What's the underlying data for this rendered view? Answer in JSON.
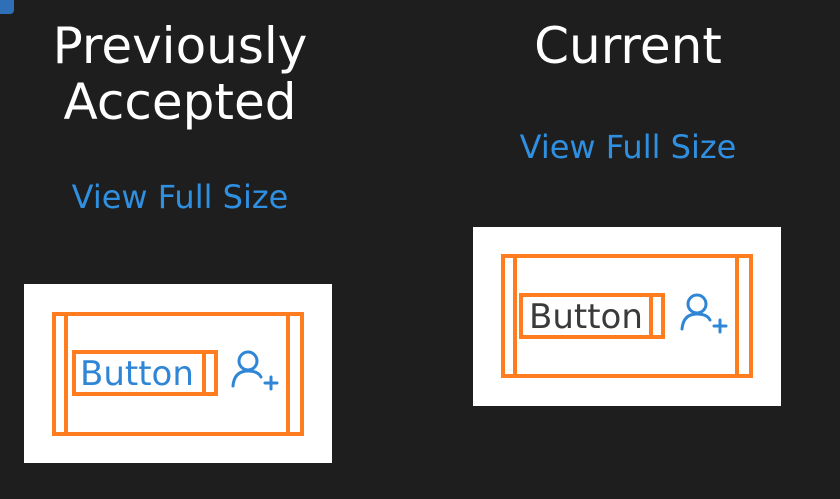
{
  "previous": {
    "heading": "Previously Accepted",
    "link_label": "View Full Size",
    "button_label": "Button"
  },
  "current": {
    "heading": "Current",
    "link_label": "View Full Size",
    "button_label": "Button"
  },
  "icons": {
    "person_add": "add-person-icon"
  },
  "colors": {
    "background": "#1e1e1e",
    "heading": "#ffffff",
    "link": "#2f8fe0",
    "highlight": "#ff7c1f",
    "previous_button_text": "#2f86d6",
    "current_button_text": "#3a3a3a",
    "icon": "#2f86d6"
  }
}
